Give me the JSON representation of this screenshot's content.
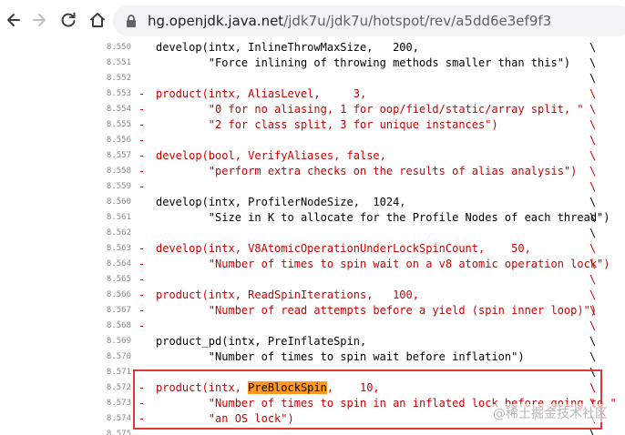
{
  "browser": {
    "url_host": "hg.openjdk.java.net",
    "url_path": "/jdk7u/jdk7u/hotspot/rev/a5dd6e3ef9f3",
    "icons": [
      "back-arrow-icon",
      "forward-arrow-icon",
      "reload-icon",
      "home-icon",
      "lock-icon"
    ]
  },
  "colors": {
    "removed": "#cc0000",
    "highlight": "#ff9a1e",
    "box": "#d93a3a"
  },
  "lines": [
    {
      "num": "8.550",
      "mark": "",
      "text": "develop(intx, InlineThrowMaxSize,   200,",
      "bs": "\\"
    },
    {
      "num": "8.551",
      "mark": "",
      "text": "        \"Force inlining of throwing methods smaller than this\")",
      "bs": "\\"
    },
    {
      "num": "8.552",
      "mark": "",
      "text": "",
      "bs": "\\"
    },
    {
      "num": "8.553",
      "mark": "-",
      "text": "product(intx, AliasLevel,     3,",
      "bs": "\\"
    },
    {
      "num": "8.554",
      "mark": "-",
      "text": "        \"0 for no aliasing, 1 for oop/field/static/array split, \"",
      "bs": "\\"
    },
    {
      "num": "8.555",
      "mark": "-",
      "text": "        \"2 for class split, 3 for unique instances\")",
      "bs": "\\"
    },
    {
      "num": "8.556",
      "mark": "-",
      "text": "",
      "bs": "\\"
    },
    {
      "num": "8.557",
      "mark": "-",
      "text": "develop(bool, VerifyAliases, false,",
      "bs": "\\"
    },
    {
      "num": "8.558",
      "mark": "-",
      "text": "        \"perform extra checks on the results of alias analysis\")",
      "bs": "\\"
    },
    {
      "num": "8.559",
      "mark": "-",
      "text": "",
      "bs": "\\"
    },
    {
      "num": "8.560",
      "mark": "",
      "text": "develop(intx, ProfilerNodeSize,  1024,",
      "bs": "\\"
    },
    {
      "num": "8.561",
      "mark": "",
      "text": "        \"Size in K to allocate for the Profile Nodes of each thread\")",
      "bs": "\\"
    },
    {
      "num": "8.562",
      "mark": "",
      "text": "",
      "bs": "\\"
    },
    {
      "num": "8.563",
      "mark": "-",
      "text": "develop(intx, V8AtomicOperationUnderLockSpinCount,    50,",
      "bs": "\\"
    },
    {
      "num": "8.564",
      "mark": "-",
      "text": "        \"Number of times to spin wait on a v8 atomic operation lock\")",
      "bs": "\\"
    },
    {
      "num": "8.565",
      "mark": "-",
      "text": "",
      "bs": "\\"
    },
    {
      "num": "8.566",
      "mark": "-",
      "text": "product(intx, ReadSpinIterations,   100,",
      "bs": "\\"
    },
    {
      "num": "8.567",
      "mark": "-",
      "text": "        \"Number of read attempts before a yield (spin inner loop)\")",
      "bs": "\\"
    },
    {
      "num": "8.568",
      "mark": "-",
      "text": "",
      "bs": "\\"
    },
    {
      "num": "8.569",
      "mark": "",
      "text": "product_pd(intx, PreInflateSpin,",
      "bs": "\\"
    },
    {
      "num": "8.570",
      "mark": "",
      "text": "        \"Number of times to spin wait before inflation\")",
      "bs": "\\"
    },
    {
      "num": "8.571",
      "mark": "",
      "text": "",
      "bs": "\\"
    },
    {
      "num": "8.572",
      "mark": "-",
      "text_before": "product(intx, ",
      "highlight": "PreBlockSpin",
      "text_after": ",    10,",
      "bs": "\\"
    },
    {
      "num": "8.573",
      "mark": "-",
      "text": "        \"Number of times to spin in an inflated lock before going to \"",
      "bs": "\\"
    },
    {
      "num": "8.574",
      "mark": "-",
      "text": "        \"an OS lock\")",
      "bs": "\\"
    },
    {
      "num": "8.575",
      "mark": "",
      "text": "",
      "bs": "\\"
    }
  ],
  "watermark": "@稀土掘金技术社区"
}
